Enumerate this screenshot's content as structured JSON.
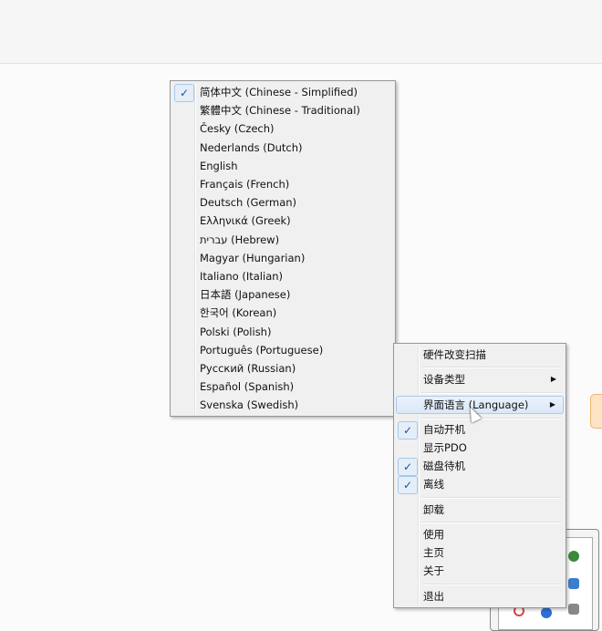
{
  "language_menu": {
    "items": [
      {
        "label": "简体中文 (Chinese - Simplified)",
        "checked": true
      },
      {
        "label": "繁體中文 (Chinese - Traditional)",
        "checked": false
      },
      {
        "label": "Česky (Czech)",
        "checked": false
      },
      {
        "label": "Nederlands (Dutch)",
        "checked": false
      },
      {
        "label": "English",
        "checked": false
      },
      {
        "label": "Français (French)",
        "checked": false
      },
      {
        "label": "Deutsch (German)",
        "checked": false
      },
      {
        "label": "Ελληνικά (Greek)",
        "checked": false
      },
      {
        "label": "עברית (Hebrew)",
        "checked": false
      },
      {
        "label": "Magyar (Hungarian)",
        "checked": false
      },
      {
        "label": "Italiano (Italian)",
        "checked": false
      },
      {
        "label": "日本語 (Japanese)",
        "checked": false
      },
      {
        "label": "한국어 (Korean)",
        "checked": false
      },
      {
        "label": "Polski (Polish)",
        "checked": false
      },
      {
        "label": "Português (Portuguese)",
        "checked": false
      },
      {
        "label": "Русский (Russian)",
        "checked": false
      },
      {
        "label": "Español (Spanish)",
        "checked": false
      },
      {
        "label": "Svenska (Swedish)",
        "checked": false
      }
    ]
  },
  "context_menu": {
    "check_glyph": "✓",
    "submenu_glyph": "▶",
    "items": {
      "rescan": "硬件改变扫描",
      "device_type": "设备类型",
      "language": "界面语言 (Language)",
      "autostart": "自动开机",
      "show_pdo": "显示PDO",
      "disk_standby": "磁盘待机",
      "offline": "离线",
      "uninstall": "卸载",
      "usage": "使用",
      "homepage": "主页",
      "about": "关于",
      "exit": "退出"
    }
  }
}
